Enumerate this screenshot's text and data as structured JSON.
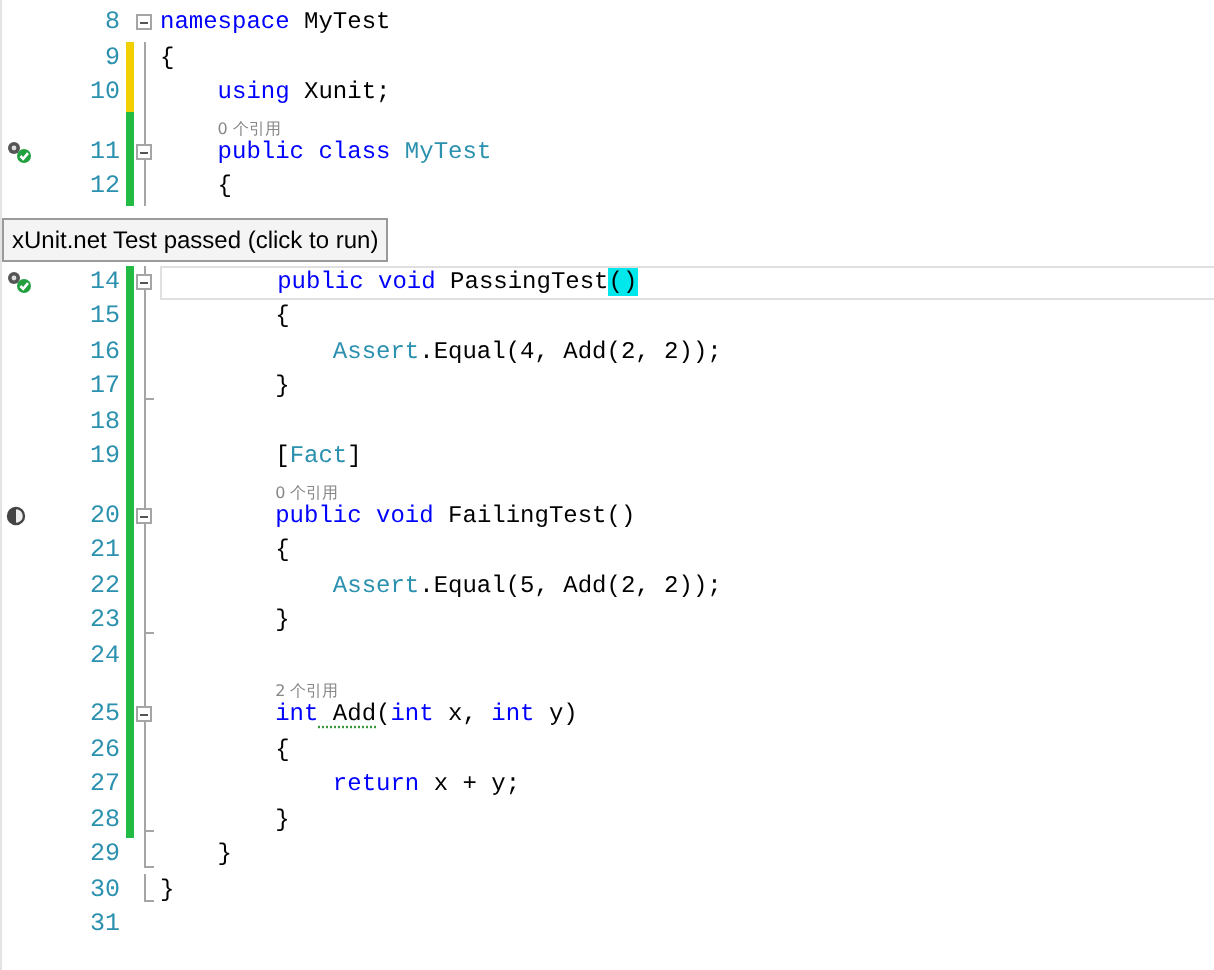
{
  "lines": [
    {
      "kind": "code",
      "number": "8",
      "fold_start": true,
      "tokens": [
        {
          "text": "namespace",
          "kind": "keyword"
        },
        {
          "text": " MyTest",
          "kind": "plain"
        }
      ]
    },
    {
      "kind": "code",
      "number": "9",
      "color": "#f2d000",
      "tokens": [
        {
          "text": "{",
          "kind": "plain"
        }
      ]
    },
    {
      "kind": "code",
      "number": "10",
      "color": "#f2d000",
      "tokens": [
        {
          "text": "    using",
          "kind": "keyword"
        },
        {
          "text": " Xunit;",
          "kind": "plain"
        }
      ]
    },
    {
      "kind": "code",
      "number": "11",
      "color": "#22bb44",
      "lens": "0 个引用",
      "test_passed": true,
      "fold_start": true,
      "tokens": [
        {
          "text": "    public",
          "kind": "keyword"
        },
        {
          "text": " class",
          "kind": "keyword"
        },
        {
          "text": " MyTest",
          "kind": "type"
        }
      ]
    },
    {
      "kind": "code",
      "number": "12",
      "color": "#22bb44",
      "tokens": [
        {
          "text": "    {",
          "kind": "plain"
        }
      ]
    },
    {
      "kind": "tooltip",
      "text": "xUnit.net Test passed (click to run)"
    },
    {
      "kind": "code",
      "number": "14",
      "color": "#22bb44",
      "test_passed": true,
      "fold_start": true,
      "current": true,
      "tokens": [
        {
          "text": "        public",
          "kind": "keyword"
        },
        {
          "text": " void",
          "kind": "keyword"
        },
        {
          "text": " PassingTest",
          "kind": "plain"
        },
        {
          "text": "()",
          "kind": "match"
        }
      ]
    },
    {
      "kind": "code",
      "number": "15",
      "color": "#22bb44",
      "tokens": [
        {
          "text": "        {",
          "kind": "plain"
        }
      ]
    },
    {
      "kind": "code",
      "number": "16",
      "color": "#22bb44",
      "tokens": [
        {
          "text": "            Assert",
          "kind": "type"
        },
        {
          "text": ".Equal(4, Add(2, 2));",
          "kind": "plain"
        }
      ]
    },
    {
      "kind": "code",
      "number": "17",
      "color": "#22bb44",
      "fold_end": true,
      "tokens": [
        {
          "text": "        }",
          "kind": "plain"
        }
      ]
    },
    {
      "kind": "code",
      "number": "18",
      "color": "#22bb44"
    },
    {
      "kind": "code",
      "number": "19",
      "color": "#22bb44",
      "tokens": [
        {
          "text": "        [",
          "kind": "plain"
        },
        {
          "text": "Fact",
          "kind": "type"
        },
        {
          "text": "]",
          "kind": "plain"
        }
      ]
    },
    {
      "kind": "code",
      "number": "20",
      "color": "#22bb44",
      "lens": "0 个引用",
      "test_passed": false,
      "fold_start": true,
      "tokens": [
        {
          "text": "        public",
          "kind": "keyword"
        },
        {
          "text": " void",
          "kind": "keyword"
        },
        {
          "text": " FailingTest()",
          "kind": "plain"
        }
      ]
    },
    {
      "kind": "code",
      "number": "21",
      "color": "#22bb44",
      "tokens": [
        {
          "text": "        {",
          "kind": "plain"
        }
      ]
    },
    {
      "kind": "code",
      "number": "22",
      "color": "#22bb44",
      "tokens": [
        {
          "text": "            Assert",
          "kind": "type"
        },
        {
          "text": ".Equal(5, Add(2, 2));",
          "kind": "plain"
        }
      ]
    },
    {
      "kind": "code",
      "number": "23",
      "color": "#22bb44",
      "fold_end": true,
      "tokens": [
        {
          "text": "        }",
          "kind": "plain"
        }
      ]
    },
    {
      "kind": "code",
      "number": "24",
      "color": "#22bb44"
    },
    {
      "kind": "code",
      "number": "25",
      "color": "#22bb44",
      "lens": "2 个引用",
      "fold_start": true,
      "tokens": [
        {
          "text": "        int",
          "kind": "keyword"
        },
        {
          "text": " Add",
          "kind": "suggest"
        },
        {
          "text": "(",
          "kind": "plain"
        },
        {
          "text": "int",
          "kind": "keyword"
        },
        {
          "text": " x, ",
          "kind": "plain"
        },
        {
          "text": "int",
          "kind": "keyword"
        },
        {
          "text": " y)",
          "kind": "plain"
        }
      ]
    },
    {
      "kind": "code",
      "number": "26",
      "color": "#22bb44",
      "tokens": [
        {
          "text": "        {",
          "kind": "plain"
        }
      ]
    },
    {
      "kind": "code",
      "number": "27",
      "color": "#22bb44",
      "tokens": [
        {
          "text": "            return",
          "kind": "keyword"
        },
        {
          "text": " x + y;",
          "kind": "plain"
        }
      ]
    },
    {
      "kind": "code",
      "number": "28",
      "color": "#22bb44",
      "fold_end": true,
      "tokens": [
        {
          "text": "        }",
          "kind": "plain"
        }
      ]
    },
    {
      "kind": "code",
      "number": "29",
      "fold_end": true,
      "tokens": [
        {
          "text": "    }",
          "kind": "plain"
        }
      ]
    },
    {
      "kind": "code",
      "number": "30",
      "fold_end": true,
      "tokens": [
        {
          "text": "}",
          "kind": "plain"
        }
      ]
    },
    {
      "kind": "code",
      "number": "31"
    }
  ]
}
